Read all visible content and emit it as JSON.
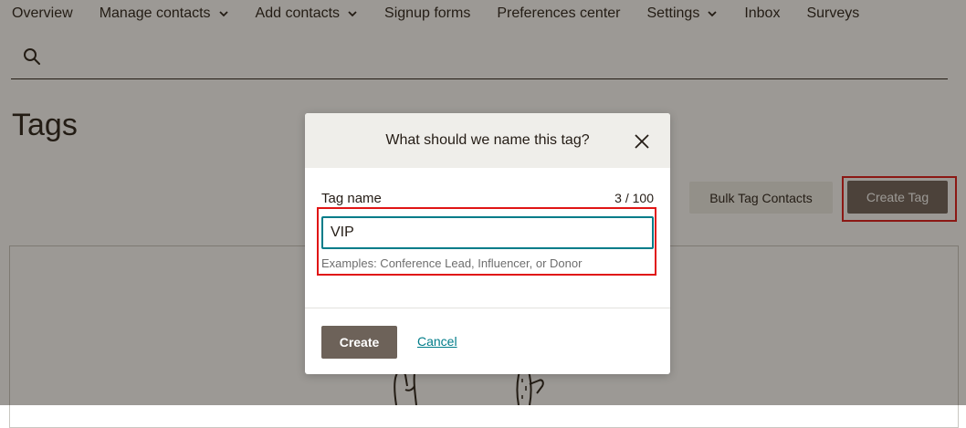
{
  "nav": {
    "items": [
      {
        "label": "Overview",
        "has_dropdown": false
      },
      {
        "label": "Manage contacts",
        "has_dropdown": true
      },
      {
        "label": "Add contacts",
        "has_dropdown": true
      },
      {
        "label": "Signup forms",
        "has_dropdown": false
      },
      {
        "label": "Preferences center",
        "has_dropdown": false
      },
      {
        "label": "Settings",
        "has_dropdown": true
      },
      {
        "label": "Inbox",
        "has_dropdown": false
      },
      {
        "label": "Surveys",
        "has_dropdown": false
      }
    ]
  },
  "page": {
    "title": "Tags",
    "bulk_button_label": "Bulk Tag Contacts",
    "create_button_label": "Create Tag"
  },
  "modal": {
    "title": "What should we name this tag?",
    "field_label": "Tag name",
    "char_count": "3 / 100",
    "input_value": "VIP",
    "help_text": "Examples: Conference Lead, Influencer, or Donor",
    "create_label": "Create",
    "cancel_label": "Cancel"
  },
  "colors": {
    "primary_button": "#6d6259",
    "input_focus": "#007c89",
    "link": "#007c89",
    "highlight": "#e01515",
    "overlay": "rgba(36,28,21,0.45)"
  },
  "icons": {
    "search": "search-icon",
    "close": "close-icon",
    "chevron": "chevron-down-icon"
  }
}
